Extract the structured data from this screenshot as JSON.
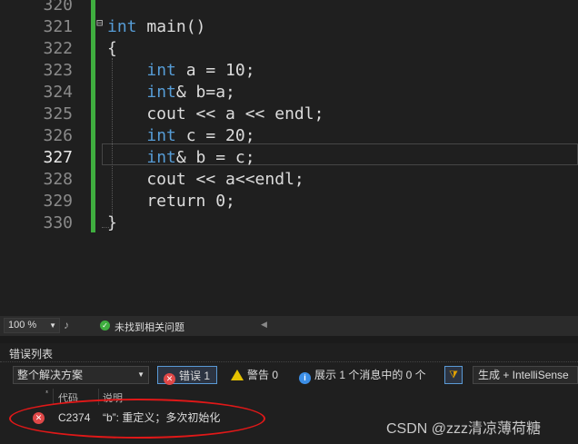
{
  "editor": {
    "line_numbers": [
      "320",
      "321",
      "322",
      "323",
      "324",
      "325",
      "326",
      "327",
      "328",
      "329",
      "330"
    ],
    "active_line": "327",
    "code_lines": [
      {
        "pre": "",
        "kw": "int",
        "post": " main()"
      },
      {
        "pre": "{",
        "kw": "",
        "post": ""
      },
      {
        "pre": "    ",
        "kw": "int",
        "post": " a = 10;"
      },
      {
        "pre": "    ",
        "kw": "int",
        "post": "& b=a;"
      },
      {
        "pre": "    cout << a << endl;",
        "kw": "",
        "post": ""
      },
      {
        "pre": "    ",
        "kw": "int",
        "post": " c = 20;"
      },
      {
        "pre": "    ",
        "kw": "int",
        "post": "& b = c;"
      },
      {
        "pre": "    cout << a<<endl;",
        "kw": "",
        "post": ""
      },
      {
        "pre": "    return 0;",
        "kw": "",
        "post": ""
      },
      {
        "pre": "}",
        "kw": "",
        "post": ""
      }
    ],
    "fold_glyph": "⊟"
  },
  "statusbar": {
    "zoom": "100 %",
    "issues_text": "未找到相关问题"
  },
  "error_list": {
    "title": "错误列表",
    "scope": "整个解决方案",
    "errors_label": "错误 1",
    "warnings_label": "警告 0",
    "messages_label": "展示 1 个消息中的 0 个",
    "build_source": "生成 + IntelliSense",
    "columns": {
      "code": "代码",
      "description": "说明"
    },
    "rows": [
      {
        "code": "C2374",
        "description": "“b”: 重定义；多次初始化"
      }
    ]
  },
  "watermark": "CSDN @zzz清凉薄荷糖",
  "colors": {
    "keyword": "#569cd6",
    "change_bar": "#3fae3f",
    "error": "#e04848",
    "annotation": "#e01818"
  }
}
